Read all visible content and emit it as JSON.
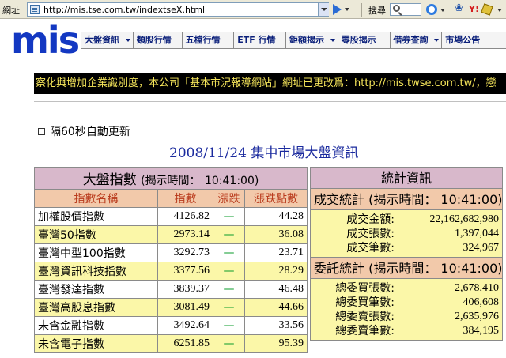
{
  "browser": {
    "address_label": "網址",
    "url": "http://mis.tse.com.tw/indextseX.html",
    "search_label": "搜尋"
  },
  "site": {
    "logo_text": "mis",
    "nav": [
      {
        "label": "大盤資訊",
        "caret": true,
        "width": 66
      },
      {
        "label": "類股行情",
        "caret": false,
        "width": 62
      },
      {
        "label": "五檔行情",
        "caret": false,
        "width": 66
      },
      {
        "label": "ETF 行情",
        "caret": false,
        "width": 66
      },
      {
        "label": "鉅額揭示",
        "caret": true,
        "width": 66
      },
      {
        "label": "零股揭示",
        "caret": false,
        "width": 66
      },
      {
        "label": "借券查詢",
        "caret": true,
        "width": 66
      },
      {
        "label": "市場公告",
        "caret": false,
        "width": 82
      }
    ],
    "marquee": "察化與增加企業識別度，本公司「基本市況報導網站」網址已更改爲：http://mis.twse.com.tw/，戀"
  },
  "auto_refresh_label": "隔60秒自動更新",
  "page_title": "2008/11/24  集中市場大盤資訊",
  "index_table": {
    "title": "大盤指數",
    "time_label": "(揭示時間：",
    "time": "10:41:00)",
    "columns": [
      "指數名稱",
      "指數",
      "漲跌",
      "漲跌點數"
    ],
    "rows": [
      {
        "name": "加權股價指數",
        "value": "4126.82",
        "change": "—",
        "points": "44.28"
      },
      {
        "name": "臺灣50指數",
        "value": "2973.14",
        "change": "—",
        "points": "36.08"
      },
      {
        "name": "臺灣中型100指數",
        "value": "3292.73",
        "change": "—",
        "points": "23.71"
      },
      {
        "name": "臺灣資訊科技指數",
        "value": "3377.56",
        "change": "—",
        "points": "28.29"
      },
      {
        "name": "臺灣發達指數",
        "value": "3839.37",
        "change": "—",
        "points": "46.48"
      },
      {
        "name": "臺灣高股息指數",
        "value": "3081.49",
        "change": "—",
        "points": "44.66"
      },
      {
        "name": "未含金融指數",
        "value": "3492.64",
        "change": "—",
        "points": "33.56"
      },
      {
        "name": "未含電子指數",
        "value": "6251.85",
        "change": "—",
        "points": "95.39"
      }
    ]
  },
  "stats": {
    "title": "統計資訊",
    "trade": {
      "heading": "成交統計 (揭示時間： 10:41:00)",
      "rows": [
        {
          "label": "成交金額:",
          "value": "22,162,682,980"
        },
        {
          "label": "成交張數:",
          "value": "1,397,044"
        },
        {
          "label": "成交筆數:",
          "value": "324,967"
        }
      ]
    },
    "order": {
      "heading": "委託統計 (揭示時間： 10:41:00)",
      "rows": [
        {
          "label": "總委買張數:",
          "value": "2,678,410"
        },
        {
          "label": "總委買筆數:",
          "value": "406,608"
        },
        {
          "label": "總委賣張數:",
          "value": "2,635,976"
        },
        {
          "label": "總委賣筆數:",
          "value": "384,195"
        }
      ]
    }
  }
}
